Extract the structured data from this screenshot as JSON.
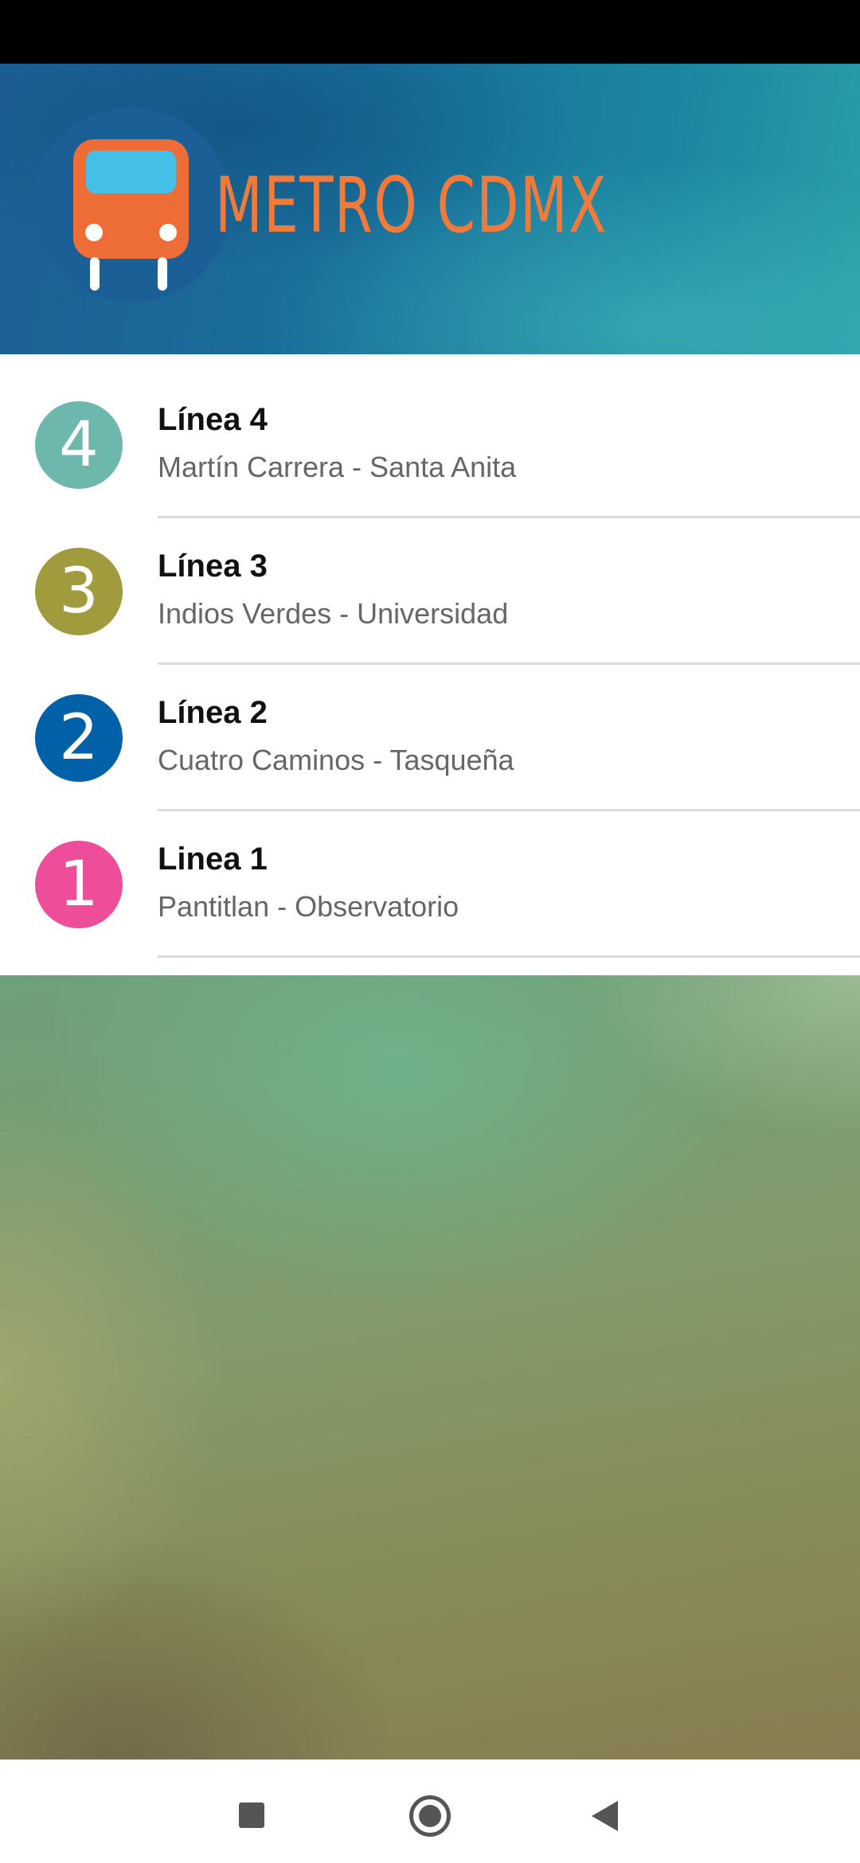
{
  "header": {
    "logo_text": "METRO CDMX",
    "logo_bus_color": "#ee6c35",
    "logo_window_color": "#45bfe6",
    "logo_text_color": "#f07a3a"
  },
  "lines": [
    {
      "number": "4",
      "title": "Línea 4",
      "route": "Martín Carrera - Santa Anita",
      "color": "#6db7ad"
    },
    {
      "number": "3",
      "title": "Línea 3",
      "route": "Indios Verdes - Universidad",
      "color": "#a09b3c"
    },
    {
      "number": "2",
      "title": "Línea 2",
      "route": "Cuatro Caminos - Tasqueña",
      "color": "#0061a8"
    },
    {
      "number": "1",
      "title": "Linea 1",
      "route": "Pantitlan - Observatorio",
      "color": "#ee4d99"
    }
  ],
  "navigation": {
    "recents_icon": "square-icon",
    "home_icon": "circle-icon",
    "back_icon": "triangle-back-icon"
  }
}
